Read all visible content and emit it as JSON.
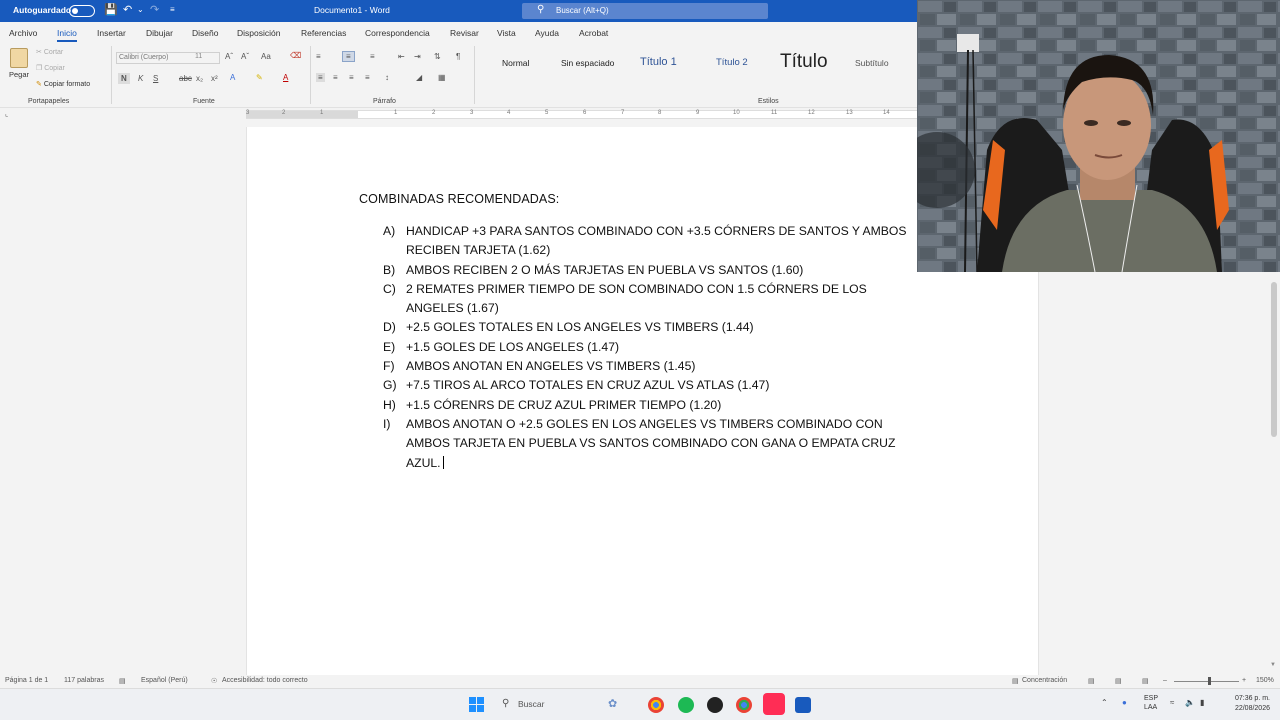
{
  "titlebar": {
    "autosave_label": "Autoguardado",
    "doc_title": "Documento1 - Word",
    "search_placeholder": "Buscar (Alt+Q)"
  },
  "menu_tabs": [
    {
      "label": "Archivo"
    },
    {
      "label": "Inicio"
    },
    {
      "label": "Insertar"
    },
    {
      "label": "Dibujar"
    },
    {
      "label": "Diseño"
    },
    {
      "label": "Disposición"
    },
    {
      "label": "Referencias"
    },
    {
      "label": "Correspondencia"
    },
    {
      "label": "Revisar"
    },
    {
      "label": "Vista"
    },
    {
      "label": "Ayuda"
    },
    {
      "label": "Acrobat"
    }
  ],
  "active_tab": "Inicio",
  "ribbon": {
    "clipboard": {
      "paste": "Pegar",
      "cut": "Cortar",
      "copy": "Copiar",
      "format_painter": "Copiar formato",
      "label": "Portapapeles"
    },
    "font": {
      "name": "Calibri (Cuerpo)",
      "size": "11",
      "label": "Fuente"
    },
    "paragraph": {
      "label": "Párrafo"
    },
    "styles": {
      "label": "Estilos",
      "items": [
        "Normal",
        "Sin espaciado",
        "Título 1",
        "Título 2",
        "Título",
        "Subtítulo"
      ]
    }
  },
  "ruler_numbers": [
    "3",
    "2",
    "1",
    "1",
    "2",
    "3",
    "4",
    "5",
    "6",
    "7",
    "8",
    "9",
    "10",
    "11",
    "12",
    "13",
    "14"
  ],
  "document": {
    "heading": "COMBINADAS RECOMENDADAS:",
    "items": [
      {
        "marker": "A)",
        "lines": [
          "HANDICAP +3 PARA SANTOS COMBINADO CON +3.5 CÓRNERS DE SANTOS Y AMBOS",
          "RECIBEN TARJETA (1.62)"
        ]
      },
      {
        "marker": "B)",
        "lines": [
          "AMBOS RECIBEN 2 O MÁS TARJETAS EN PUEBLA VS SANTOS (1.60)"
        ]
      },
      {
        "marker": "C)",
        "lines": [
          "2 REMATES PRIMER TIEMPO DE SON COMBINADO CON 1.5 CÓRNERS DE LOS",
          "ANGELES (1.67)"
        ]
      },
      {
        "marker": "D)",
        "lines": [
          "+2.5 GOLES TOTALES EN LOS ANGELES VS TIMBERS (1.44)"
        ]
      },
      {
        "marker": "E)",
        "lines": [
          "+1.5 GOLES DE LOS ANGELES (1.47)"
        ]
      },
      {
        "marker": "F)",
        "lines": [
          "AMBOS ANOTAN EN ANGELES VS TIMBERS (1.45)"
        ]
      },
      {
        "marker": "G)",
        "lines": [
          "+7.5 TIROS AL ARCO TOTALES EN CRUZ AZUL VS ATLAS (1.47)"
        ]
      },
      {
        "marker": "H)",
        "lines": [
          "+1.5 CÓRENRS DE CRUZ AZUL PRIMER TIEMPO (1.20)"
        ]
      },
      {
        "marker": "I)",
        "lines": [
          "AMBOS ANOTAN O +2.5 GOLES EN LOS ANGELES VS TIMBERS COMBINADO CON",
          "AMBOS TARJETA EN PUEBLA VS SANTOS COMBINADO CON GANA O EMPATA CRUZ",
          "AZUL."
        ]
      }
    ]
  },
  "statusbar": {
    "page": "Página 1 de 1",
    "words": "117 palabras",
    "language": "Español (Perú)",
    "accessibility": "Accesibilidad: todo correcto",
    "focus": "Concentración",
    "zoom": "150%"
  },
  "taskbar": {
    "search_placeholder": "Buscar",
    "lang_top": "ESP",
    "lang_bottom": "LAA",
    "time": "07:36 p. m.",
    "date": "22/08/2026"
  },
  "colors": {
    "word_blue": "#185abd",
    "accent_red": "#e81123"
  }
}
